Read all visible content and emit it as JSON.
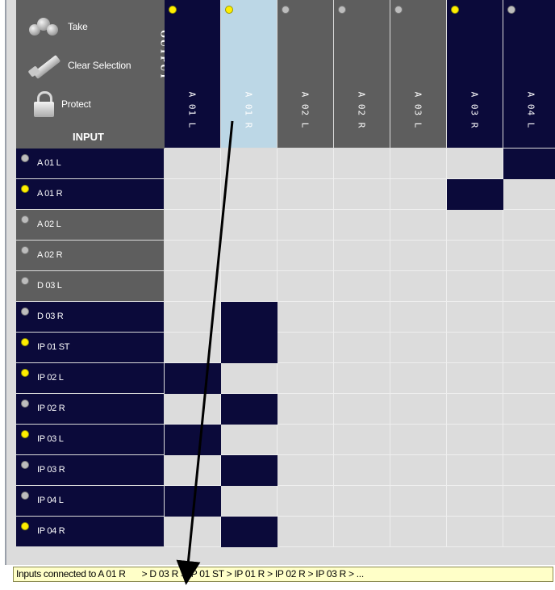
{
  "controls": {
    "take": "Take",
    "clear_selection": "Clear Selection",
    "protect": "Protect",
    "output_label": "OUTPUT",
    "input_label": "INPUT"
  },
  "columns": [
    {
      "label": "A 01 L",
      "indicator": "on",
      "style": "dark"
    },
    {
      "label": "A 01 R",
      "indicator": "on",
      "style": "selected"
    },
    {
      "label": "A 02 L",
      "indicator": "off",
      "style": "gray"
    },
    {
      "label": "A 02 R",
      "indicator": "off",
      "style": "gray"
    },
    {
      "label": "A 03 L",
      "indicator": "off",
      "style": "gray"
    },
    {
      "label": "A 03 R",
      "indicator": "on",
      "style": "dark"
    },
    {
      "label": "A 04 L",
      "indicator": "off",
      "style": "dark"
    }
  ],
  "rows": [
    {
      "label": "A 01 L",
      "indicator": "off",
      "style": "dark",
      "connected_to": [
        6
      ]
    },
    {
      "label": "A 01 R",
      "indicator": "on",
      "style": "dark",
      "connected_to": [
        5
      ]
    },
    {
      "label": "A 02 L",
      "indicator": "off",
      "style": "gray",
      "connected_to": []
    },
    {
      "label": "A 02 R",
      "indicator": "off",
      "style": "gray",
      "connected_to": []
    },
    {
      "label": "D 03 L",
      "indicator": "off",
      "style": "gray",
      "connected_to": []
    },
    {
      "label": "D 03 R",
      "indicator": "off",
      "style": "dark",
      "connected_to": [
        1
      ]
    },
    {
      "label": "IP 01 ST",
      "indicator": "on",
      "style": "dark",
      "connected_to": [
        1
      ]
    },
    {
      "label": "IP 02 L",
      "indicator": "on",
      "style": "dark",
      "connected_to": [
        0
      ]
    },
    {
      "label": "IP 02 R",
      "indicator": "off",
      "style": "dark",
      "connected_to": [
        1
      ]
    },
    {
      "label": "IP 03 L",
      "indicator": "on",
      "style": "dark",
      "connected_to": [
        0
      ]
    },
    {
      "label": "IP 03 R",
      "indicator": "off",
      "style": "dark",
      "connected_to": [
        1
      ]
    },
    {
      "label": "IP 04 L",
      "indicator": "off",
      "style": "dark",
      "connected_to": [
        0
      ]
    },
    {
      "label": "IP 04 R",
      "indicator": "on",
      "style": "dark",
      "connected_to": [
        1
      ]
    }
  ],
  "status": {
    "prefix": "Inputs connected to A 01 R",
    "list": "> D 03 R   > IP 01 ST > IP 01 R > IP 02 R > IP 03 R >  ..."
  },
  "colors": {
    "connected": "#0b0a3a",
    "selected_column": "#bcd7e6",
    "indicator_on": "#ffee00",
    "indicator_off": "#bdbdbd",
    "status_bg": "#ffffc8"
  }
}
